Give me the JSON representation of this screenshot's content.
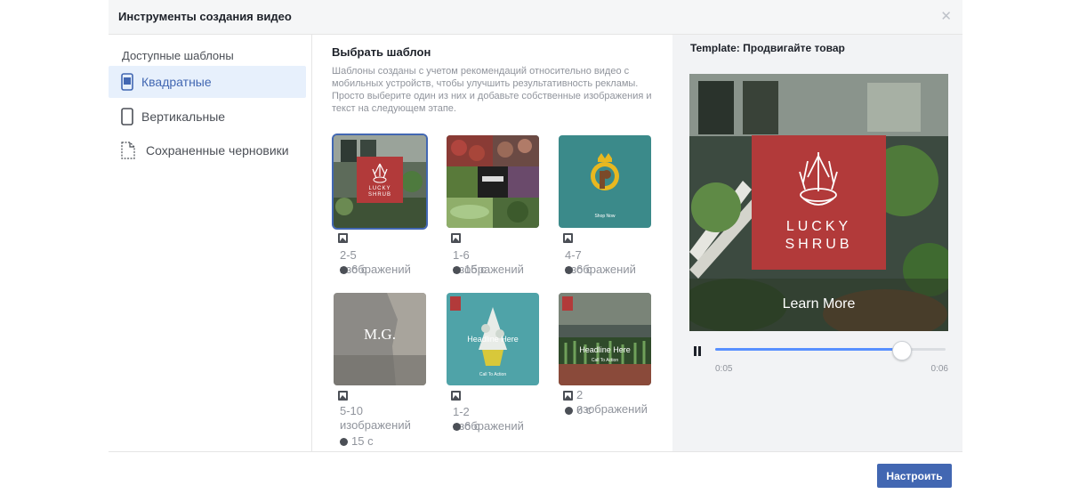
{
  "dialog": {
    "title": "Инструменты создания видео",
    "close_icon": "close-icon"
  },
  "sidebar": {
    "section_title": "Доступные шаблоны",
    "items": [
      {
        "label": "Квадратные",
        "icon": "square-phone-icon",
        "active": true
      },
      {
        "label": "Вертикальные",
        "icon": "vertical-phone-icon",
        "active": false
      },
      {
        "label": "Сохраненные черновики",
        "icon": "document-icon",
        "active": false
      }
    ]
  },
  "templates_panel": {
    "title": "Выбрать шаблон",
    "description": "Шаблоны созданы с учетом рекомендаций относительно видео с мобильных устройств, чтобы улучшить результативность рекламы. Просто выберите один из них и добавьте собственные изображения и текст на следующем этапе.",
    "templates": [
      {
        "images": "2-5 изображений",
        "duration": "6 с",
        "thumb_text": "LUCKY SHRUB",
        "selected": true
      },
      {
        "images": "1-6 изображений",
        "duration": "15 с",
        "thumb_text": "",
        "selected": false
      },
      {
        "images": "4-7 изображений",
        "duration": "6 с",
        "thumb_text": "Shop Now",
        "selected": false
      },
      {
        "images": "5-10 изображений",
        "duration": "15 с",
        "thumb_text": "M.G.",
        "selected": false
      },
      {
        "images": "1-2 изображений",
        "duration": "6 с",
        "thumb_text": "Headline Here",
        "thumb_cta": "Call To Action",
        "selected": false
      },
      {
        "images": "2 изображений",
        "duration": "6 с",
        "thumb_text": "Headline Here",
        "thumb_cta": "Call To Action",
        "selected": false
      }
    ]
  },
  "preview": {
    "title": "Template: Продвигайте товар",
    "brand_line1": "LUCKY",
    "brand_line2": "SHRUB",
    "cta": "Learn More",
    "time_current": "0:05",
    "time_total": "0:06",
    "progress": 0.81
  },
  "footer": {
    "primary_button": "Настроить"
  },
  "colors": {
    "accent": "#4267b2",
    "brand_red": "#b23a3a",
    "progress": "#5890ff"
  }
}
